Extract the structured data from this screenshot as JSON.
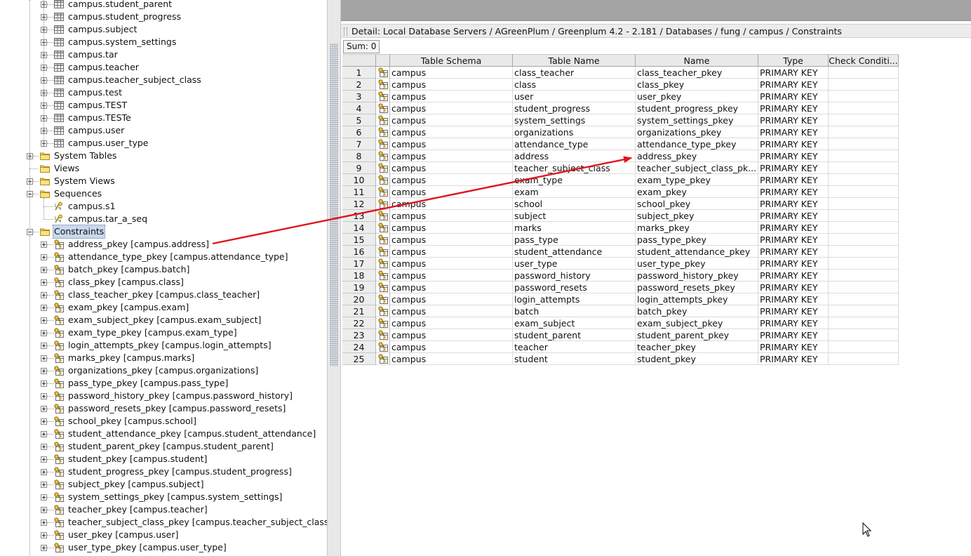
{
  "tree": {
    "tables": [
      "campus.student_parent",
      "campus.student_progress",
      "campus.subject",
      "campus.system_settings",
      "campus.tar",
      "campus.teacher",
      "campus.teacher_subject_class",
      "campus.test",
      "campus.TEST",
      "campus.TESTe",
      "campus.user",
      "campus.user_type"
    ],
    "folders": {
      "system_tables": "System Tables",
      "views": "Views",
      "system_views": "System Views",
      "sequences": "Sequences",
      "constraints": "Constraints"
    },
    "sequences": [
      "campus.s1",
      "campus.tar_a_seq"
    ],
    "constraints": [
      "address_pkey [campus.address]",
      "attendance_type_pkey [campus.attendance_type]",
      "batch_pkey [campus.batch]",
      "class_pkey [campus.class]",
      "class_teacher_pkey [campus.class_teacher]",
      "exam_pkey [campus.exam]",
      "exam_subject_pkey [campus.exam_subject]",
      "exam_type_pkey [campus.exam_type]",
      "login_attempts_pkey [campus.login_attempts]",
      "marks_pkey [campus.marks]",
      "organizations_pkey [campus.organizations]",
      "pass_type_pkey [campus.pass_type]",
      "password_history_pkey [campus.password_history]",
      "password_resets_pkey [campus.password_resets]",
      "school_pkey [campus.school]",
      "student_attendance_pkey [campus.student_attendance]",
      "student_parent_pkey [campus.student_parent]",
      "student_pkey [campus.student]",
      "student_progress_pkey [campus.student_progress]",
      "subject_pkey [campus.subject]",
      "system_settings_pkey [campus.system_settings]",
      "teacher_pkey [campus.teacher]",
      "teacher_subject_class_pkey [campus.teacher_subject_class]",
      "user_pkey [campus.user]",
      "user_type_pkey [campus.user_type]"
    ]
  },
  "detail": {
    "path": "Detail: Local Database Servers / AGreenPlum / Greenplum 4.2 - 2.181 / Databases / fung / campus / Constraints",
    "sum_label": "Sum: 0"
  },
  "grid": {
    "columns": [
      "Table Schema",
      "Table Name",
      "Name",
      "Type",
      "Check Conditi..."
    ],
    "rows": [
      [
        "1",
        "campus",
        "class_teacher",
        "class_teacher_pkey",
        "PRIMARY KEY",
        ""
      ],
      [
        "2",
        "campus",
        "class",
        "class_pkey",
        "PRIMARY KEY",
        ""
      ],
      [
        "3",
        "campus",
        "user",
        "user_pkey",
        "PRIMARY KEY",
        ""
      ],
      [
        "4",
        "campus",
        "student_progress",
        "student_progress_pkey",
        "PRIMARY KEY",
        ""
      ],
      [
        "5",
        "campus",
        "system_settings",
        "system_settings_pkey",
        "PRIMARY KEY",
        ""
      ],
      [
        "6",
        "campus",
        "organizations",
        "organizations_pkey",
        "PRIMARY KEY",
        ""
      ],
      [
        "7",
        "campus",
        "attendance_type",
        "attendance_type_pkey",
        "PRIMARY KEY",
        ""
      ],
      [
        "8",
        "campus",
        "address",
        "address_pkey",
        "PRIMARY KEY",
        ""
      ],
      [
        "9",
        "campus",
        "teacher_subject_class",
        "teacher_subject_class_pk...",
        "PRIMARY KEY",
        ""
      ],
      [
        "10",
        "campus",
        "exam_type",
        "exam_type_pkey",
        "PRIMARY KEY",
        ""
      ],
      [
        "11",
        "campus",
        "exam",
        "exam_pkey",
        "PRIMARY KEY",
        ""
      ],
      [
        "12",
        "campus",
        "school",
        "school_pkey",
        "PRIMARY KEY",
        ""
      ],
      [
        "13",
        "campus",
        "subject",
        "subject_pkey",
        "PRIMARY KEY",
        ""
      ],
      [
        "14",
        "campus",
        "marks",
        "marks_pkey",
        "PRIMARY KEY",
        ""
      ],
      [
        "15",
        "campus",
        "pass_type",
        "pass_type_pkey",
        "PRIMARY KEY",
        ""
      ],
      [
        "16",
        "campus",
        "student_attendance",
        "student_attendance_pkey",
        "PRIMARY KEY",
        ""
      ],
      [
        "17",
        "campus",
        "user_type",
        "user_type_pkey",
        "PRIMARY KEY",
        ""
      ],
      [
        "18",
        "campus",
        "password_history",
        "password_history_pkey",
        "PRIMARY KEY",
        ""
      ],
      [
        "19",
        "campus",
        "password_resets",
        "password_resets_pkey",
        "PRIMARY KEY",
        ""
      ],
      [
        "20",
        "campus",
        "login_attempts",
        "login_attempts_pkey",
        "PRIMARY KEY",
        ""
      ],
      [
        "21",
        "campus",
        "batch",
        "batch_pkey",
        "PRIMARY KEY",
        ""
      ],
      [
        "22",
        "campus",
        "exam_subject",
        "exam_subject_pkey",
        "PRIMARY KEY",
        ""
      ],
      [
        "23",
        "campus",
        "student_parent",
        "student_parent_pkey",
        "PRIMARY KEY",
        ""
      ],
      [
        "24",
        "campus",
        "teacher",
        "teacher_pkey",
        "PRIMARY KEY",
        ""
      ],
      [
        "25",
        "campus",
        "student",
        "student_pkey",
        "PRIMARY KEY",
        ""
      ]
    ]
  },
  "icons": {
    "table": "table-icon",
    "folder": "folder-icon",
    "sequence": "sequence-icon",
    "constraint": "key-icon",
    "pointer": "mouse-pointer-icon"
  },
  "colors": {
    "annotation_arrow": "#e0141e",
    "folder": "#f2d24a",
    "selection": "#c9d8ef",
    "header_bar": "#a4a4a4"
  }
}
